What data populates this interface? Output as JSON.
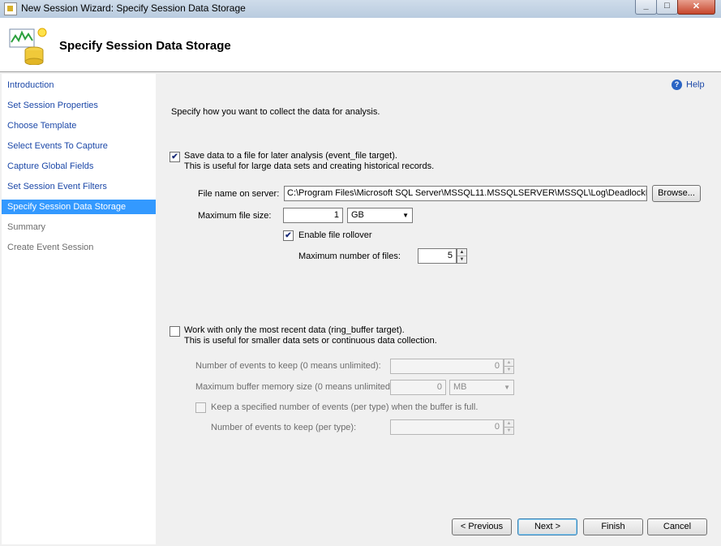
{
  "window": {
    "title": "New Session Wizard: Specify Session Data Storage"
  },
  "header": {
    "title": "Specify Session Data Storage"
  },
  "sidebar": {
    "items": [
      {
        "label": "Introduction",
        "state": "link"
      },
      {
        "label": "Set Session Properties",
        "state": "link"
      },
      {
        "label": "Choose Template",
        "state": "link"
      },
      {
        "label": "Select Events To Capture",
        "state": "link"
      },
      {
        "label": "Capture Global Fields",
        "state": "link"
      },
      {
        "label": "Set Session Event Filters",
        "state": "link"
      },
      {
        "label": "Specify Session Data Storage",
        "state": "active"
      },
      {
        "label": "Summary",
        "state": "disabled"
      },
      {
        "label": "Create Event Session",
        "state": "disabled"
      }
    ]
  },
  "help": {
    "label": "Help"
  },
  "main": {
    "intro": "Specify how you want to collect the data for analysis.",
    "file_target": {
      "checked": true,
      "label": "Save data to a file for later analysis (event_file target).",
      "description": "This is useful for large data sets and creating historical records.",
      "file_name_label": "File name on server:",
      "file_name_value": "C:\\Program Files\\Microsoft SQL Server\\MSSQL11.MSSQLSERVER\\MSSQL\\Log\\DeadlockE",
      "browse_label": "Browse...",
      "max_size_label": "Maximum file size:",
      "max_size_value": "1",
      "max_size_unit": "GB",
      "rollover_checked": true,
      "rollover_label": "Enable file rollover",
      "max_files_label": "Maximum number of files:",
      "max_files_value": "5"
    },
    "ring_buffer": {
      "checked": false,
      "label": "Work with only the most recent data (ring_buffer target).",
      "description": "This is useful for smaller data sets or continuous data collection.",
      "events_to_keep_label": "Number of events to keep (0 means unlimited):",
      "events_to_keep_value": "0",
      "buffer_memory_label": "Maximum buffer memory size (0 means unlimited):",
      "buffer_memory_value": "0",
      "buffer_memory_unit": "MB",
      "keep_per_type_checked": false,
      "keep_per_type_label": "Keep a specified number of events (per type) when the buffer is full.",
      "per_type_label": "Number of events to keep (per type):",
      "per_type_value": "0"
    }
  },
  "footer": {
    "previous_label": "< Previous",
    "next_label": "Next >",
    "finish_label": "Finish",
    "cancel_label": "Cancel"
  },
  "icons": {
    "checkmark": "✔",
    "spin_up": "▲",
    "spin_down": "▼",
    "dropdown": "▼",
    "minimize": "_",
    "maximize": "□",
    "close": "✕"
  }
}
